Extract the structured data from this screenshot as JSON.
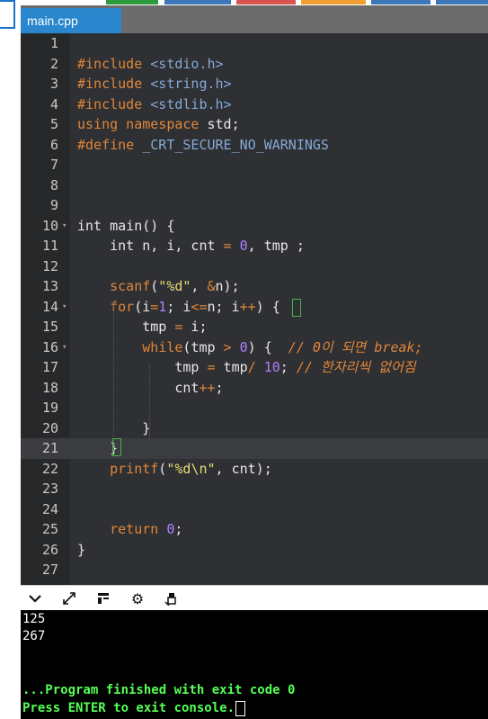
{
  "window": {
    "accent": "#2a87cd",
    "top_chips": [
      "#2d9a3f",
      "#3c78b8",
      "#d9534f",
      "#f0a030",
      "#3c78b8",
      "#3c78b8"
    ]
  },
  "tab": {
    "label": "main.cpp"
  },
  "editor": {
    "lines": [
      {
        "n": "1"
      },
      {
        "n": "2"
      },
      {
        "n": "3"
      },
      {
        "n": "4"
      },
      {
        "n": "5"
      },
      {
        "n": "6"
      },
      {
        "n": "7"
      },
      {
        "n": "8"
      },
      {
        "n": "9"
      },
      {
        "n": "10"
      },
      {
        "n": "11"
      },
      {
        "n": "12"
      },
      {
        "n": "13"
      },
      {
        "n": "14"
      },
      {
        "n": "15"
      },
      {
        "n": "16"
      },
      {
        "n": "17"
      },
      {
        "n": "18"
      },
      {
        "n": "19"
      },
      {
        "n": "20"
      },
      {
        "n": "21"
      },
      {
        "n": "22"
      },
      {
        "n": "23"
      },
      {
        "n": "24"
      },
      {
        "n": "25"
      },
      {
        "n": "26"
      },
      {
        "n": "27"
      }
    ],
    "active_line": "21",
    "code": {
      "l2": {
        "kw": "#include",
        "hdr": "<stdio.h>"
      },
      "l3": {
        "kw": "#include",
        "hdr": "<string.h>"
      },
      "l4": {
        "kw": "#include",
        "hdr": "<stdlib.h>"
      },
      "l5": {
        "kw": "using namespace",
        "rest": " std;"
      },
      "l6": {
        "kw": "#define",
        "macro": "_CRT_SECURE_NO_WARNINGS"
      },
      "l10": {
        "text": "int main() {"
      },
      "l11": {
        "a": "int n, i, cnt ",
        "op": "=",
        "sp": " ",
        "num": "0",
        "b": ", tmp ;"
      },
      "l13": {
        "fn": "scanf",
        "p1": "(",
        "str": "\"%d\"",
        "p2": ", ",
        "op": "&",
        "p3": "n);"
      },
      "l14": {
        "kw": "for",
        "p1": "(i",
        "op1": "=",
        "n1": "1",
        "p2": "; i",
        "op2": "<=",
        "p3": "n; i",
        "op3": "++",
        "p4": ") ",
        "br": "{"
      },
      "l15": {
        "a": "tmp ",
        "op": "=",
        "b": " i;"
      },
      "l16": {
        "kw": "while",
        "a": "(tmp ",
        "op": ">",
        "sp": " ",
        "num": "0",
        "b": ") {  ",
        "cm": "// 0이 되면 break;"
      },
      "l17": {
        "a": "tmp ",
        "op": "=",
        "b": " tmp",
        "op2": "/",
        "sp": " ",
        "num": "10",
        "c": "; ",
        "cm": "// 한자리씩 없어짐"
      },
      "l18": {
        "a": "cnt",
        "op": "++",
        "b": ";"
      },
      "l20": {
        "text": "}"
      },
      "l21": {
        "text": "}"
      },
      "l22": {
        "fn": "printf",
        "p1": "(",
        "str": "\"%d\\n\"",
        "p2": ", cnt);"
      },
      "l25": {
        "kw": "return",
        "sp": " ",
        "num": "0",
        "b": ";"
      },
      "l26": {
        "text": "}"
      }
    }
  },
  "console_toolbar": {
    "icons": [
      "chevron-down-icon",
      "expand-icon",
      "layout-icon",
      "gear-icon",
      "clear-icon"
    ]
  },
  "console": {
    "out1": "125",
    "out2": "267",
    "finish": "...Program finished with exit code 0",
    "press": "Press ENTER to exit console."
  }
}
